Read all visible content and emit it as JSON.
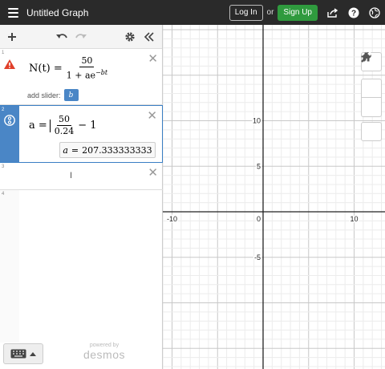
{
  "topbar": {
    "title": "Untitled Graph",
    "login_label": "Log In",
    "or_label": "or",
    "signup_label": "Sign Up"
  },
  "expressions": [
    {
      "index": "1",
      "lhs": "N(t) =",
      "numerator": "50",
      "denominator": "1 + ae",
      "exponent": "−bt",
      "slider_label": "add slider:",
      "slider_var": "b",
      "warning": true
    },
    {
      "index": "2",
      "lhs": "a =",
      "numerator": "50",
      "denominator": "0.24",
      "tail": "− 1",
      "eval_var": "a",
      "eval_eq": "=",
      "eval_value": "207.333333333"
    },
    {
      "index": "3"
    },
    {
      "index": "4"
    }
  ],
  "footer": {
    "powered_by": "powered by",
    "brand": "desmos"
  },
  "graph": {
    "x_min": -15,
    "x_max": 15,
    "y_min": -10,
    "y_max": 10,
    "x_ticks": [
      "-10",
      "0",
      "10"
    ],
    "y_ticks": [
      "10",
      "5",
      "-5"
    ]
  },
  "colors": {
    "accent_blue": "#4a86c6",
    "signup_green": "#2f9a3e",
    "warning_red": "#e0402a",
    "topbar": "#2a2a2a"
  },
  "icons": {
    "menu": "hamburger-icon",
    "share": "share-icon",
    "help": "help-icon",
    "language": "globe-icon",
    "add": "plus-icon",
    "undo": "undo-icon",
    "redo": "redo-icon",
    "settings": "gear-icon",
    "collapse": "double-chevron-left-icon",
    "wrench": "wrench-icon",
    "zoom_in": "plus-icon",
    "zoom_out": "minus-icon",
    "home": "home-icon",
    "keyboard": "keyboard-icon"
  }
}
